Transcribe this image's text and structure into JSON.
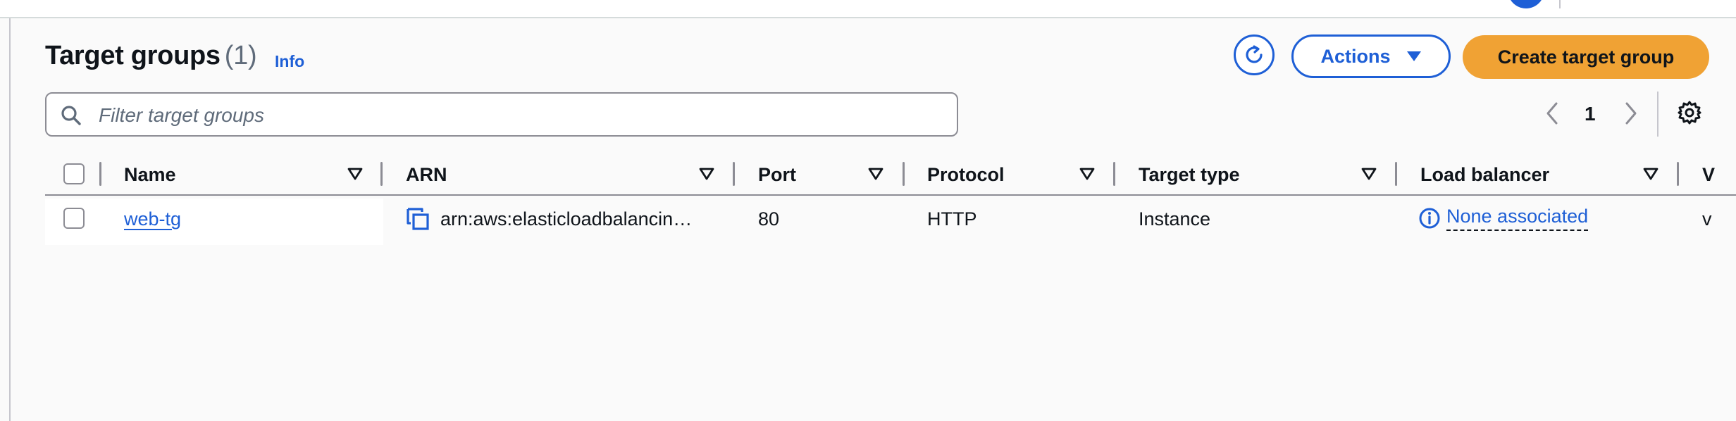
{
  "header": {
    "title": "Target groups",
    "count": "(1)",
    "info_label": "Info"
  },
  "toolbar": {
    "actions_label": "Actions",
    "create_label": "Create target group"
  },
  "filter": {
    "placeholder": "Filter target groups",
    "value": ""
  },
  "pagination": {
    "current_page": "1"
  },
  "table": {
    "columns": [
      "Name",
      "ARN",
      "Port",
      "Protocol",
      "Target type",
      "Load balancer",
      "V"
    ],
    "rows": [
      {
        "name": "web-tg",
        "arn": "arn:aws:elasticloadbalancin…",
        "port": "80",
        "protocol": "HTTP",
        "target_type": "Instance",
        "load_balancer": "None associated",
        "extra": "v"
      }
    ]
  },
  "icons": {
    "refresh": "refresh-icon",
    "actions_caret": "caret-down-icon",
    "search": "search-icon",
    "prev": "chevron-left-icon",
    "next": "chevron-right-icon",
    "settings": "gear-icon",
    "sort": "sort-down-icon",
    "copy": "copy-icon",
    "info": "info-icon"
  },
  "colors": {
    "primary": "#1e5fd6",
    "cta": "#f0a234",
    "text": "#0f141a",
    "muted": "#5f6b7a"
  }
}
